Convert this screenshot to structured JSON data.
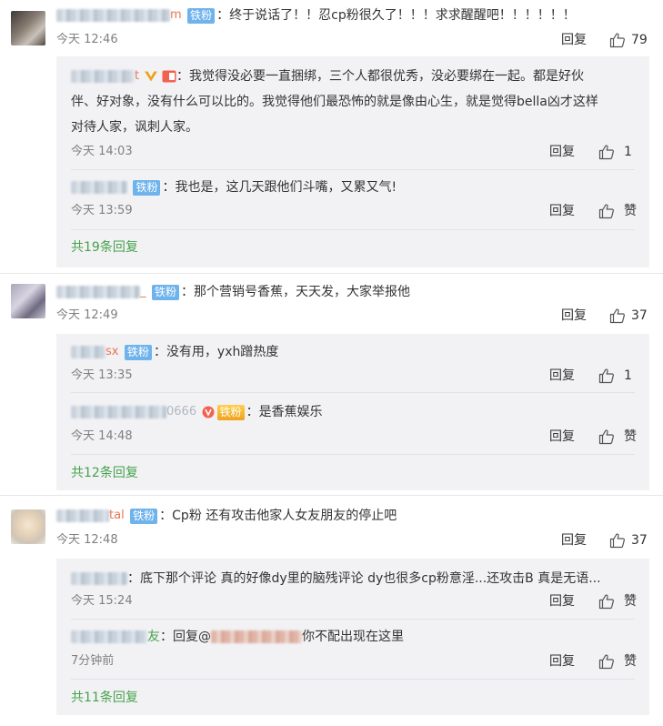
{
  "comments": [
    {
      "user_tail": "m",
      "badge": "铁粉",
      "text": "终于说话了！！忍cp粉很久了！！！求求醒醒吧！！！！！！",
      "time": "今天 12:46",
      "reply_label": "回复",
      "likes": "79",
      "replies": [
        {
          "user_tail": "t",
          "text_line1": "我觉得没必要一直捆绑，三个人都很优秀，没必要绑在一起。都是好伙",
          "text_line2": "伴、好对象，没有什么可以比的。我觉得他们最恐怖的就是像由心生，就是觉得bella凶才这样",
          "text_line3": "对待人家，讽刺人家。",
          "time": "今天 14:03",
          "reply_label": "回复",
          "likes": "1"
        },
        {
          "badge": "铁粉",
          "text": "我也是，这几天跟他们斗嘴，又累又气!",
          "time": "今天 13:59",
          "reply_label": "回复",
          "likes": "赞"
        }
      ],
      "more": "共19条回复"
    },
    {
      "user_tail": "_",
      "badge": "铁粉",
      "text": "那个营销号香蕉，天天发，大家举报他",
      "time": "今天 12:49",
      "reply_label": "回复",
      "likes": "37",
      "replies": [
        {
          "user_tail": "sx",
          "badge": "铁粉",
          "text": "没有用，yxh蹭热度",
          "time": "今天 13:35",
          "reply_label": "回复",
          "likes": "1"
        },
        {
          "user_tail": "0666",
          "badge": "铁粉",
          "text": "是香蕉娱乐",
          "time": "今天 14:48",
          "reply_label": "回复",
          "likes": "赞"
        }
      ],
      "more": "共12条回复"
    },
    {
      "user_tail": "tal",
      "badge": "铁粉",
      "text": "Cp粉 还有攻击他家人女友朋友的停止吧",
      "time": "今天 12:48",
      "reply_label": "回复",
      "likes": "37",
      "replies": [
        {
          "text": "底下那个评论 真的好像dy里的脑残评论 dy也很多cp粉意淫...还攻击B 真是无语...",
          "time": "今天 15:24",
          "reply_label": "回复",
          "likes": "赞"
        },
        {
          "user_tail": "友",
          "reply_prefix": "回复@",
          "text": "你不配出现在这里",
          "time": "7分钟前",
          "reply_label": "回复",
          "likes": "赞"
        }
      ],
      "more": "共11条回复"
    }
  ]
}
